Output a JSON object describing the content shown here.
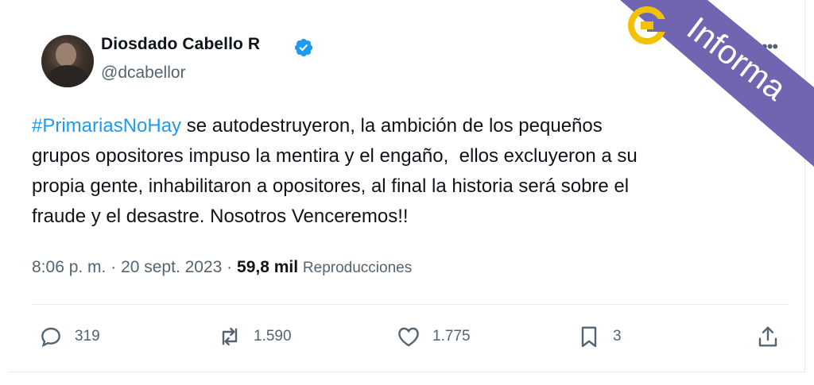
{
  "author": {
    "name": "Diosdado Cabello R",
    "handle": "@dcabellor"
  },
  "tweet": {
    "hashtag": "#PrimariasNoHay",
    "line1_rest": " se autodestruyeron, la ambición de los pequeños",
    "line2": "grupos opositores impuso la mentira y el engaño,  ellos excluyeron a su",
    "line3": "propia gente, inhabilitaron a opositores, al final la historia será sobre el",
    "line4": "fraude y el desastre. Nosotros Venceremos!!"
  },
  "meta": {
    "time": "8:06 p. m.",
    "sep": " · ",
    "date": "20 sept. 2023",
    "views": "59,8 mil",
    "views_label": "Reproducciones"
  },
  "actions": {
    "replies": "319",
    "reposts": "1.590",
    "likes": "1.775",
    "bookmarks": "3"
  },
  "watermark": {
    "text": "Informa",
    "colors": {
      "band": "#6f65b0",
      "logo": "#f2c200"
    }
  },
  "icons": [
    "verified-badge-icon",
    "more-icon",
    "reply-icon",
    "repost-icon",
    "like-icon",
    "bookmark-icon",
    "share-icon"
  ]
}
